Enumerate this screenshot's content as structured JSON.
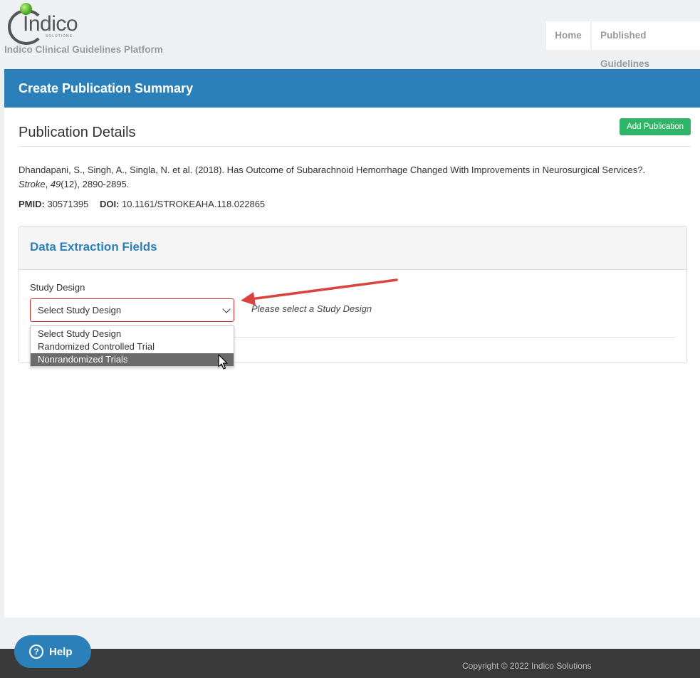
{
  "brand": {
    "logo_text": "Indico",
    "logo_sub": "SOLUTIONS",
    "platform_name": "Indico Clinical Guidelines Platform"
  },
  "nav": {
    "home": "Home",
    "published": "Published Guidelines"
  },
  "page": {
    "title": "Create Publication Summary",
    "section_title": "Publication Details",
    "add_button": "Add Publication"
  },
  "citation": {
    "authors_title": "Dhandapani, S., Singh, A., Singla, N. et al. (2018). Has Outcome of Subarachnoid Hemorrhage Changed With Improvements in Neurosurgical Services?.",
    "journal": "Stroke",
    "volume_issue_pages_vol": "49",
    "volume_issue_pages_rest": "(12), 2890-2895."
  },
  "ids": {
    "pmid_label": "PMID:",
    "pmid": "30571395",
    "doi_label": "DOI:",
    "doi": "10.1161/STROKEAHA.118.022865"
  },
  "extraction": {
    "panel_title": "Data Extraction Fields",
    "field_label": "Study Design",
    "selected": "Select Study Design",
    "hint": "Please select a Study Design",
    "options": [
      "Select Study Design",
      "Randomized Controlled Trial",
      "Nonrandomized Trials"
    ],
    "highlighted_option": "Nonrandomized Trials"
  },
  "help": {
    "label": "Help"
  },
  "footer": {
    "copyright": "Copyright © 2022 Indico Solutions"
  },
  "colors": {
    "header_blue": "#2b80b9",
    "add_green": "#2fb468",
    "error_red": "#c9302c",
    "annotation_arrow": "#d9453e"
  }
}
